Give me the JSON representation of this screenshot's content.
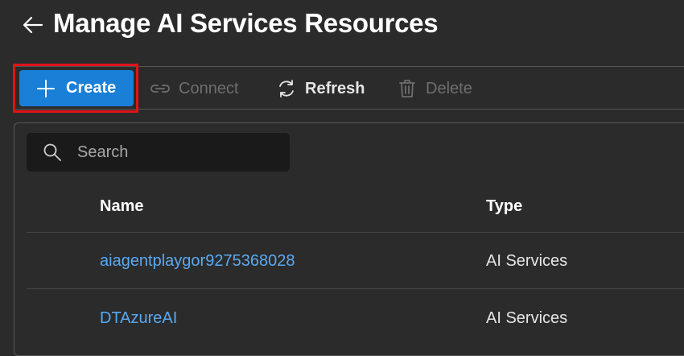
{
  "header": {
    "title": "Manage AI Services Resources"
  },
  "toolbar": {
    "create_label": "Create",
    "connect_label": "Connect",
    "refresh_label": "Refresh",
    "delete_label": "Delete"
  },
  "search": {
    "placeholder": "Search",
    "value": ""
  },
  "table": {
    "columns": [
      "Name",
      "Type"
    ],
    "rows": [
      {
        "name": "aiagentplaygor9275368028",
        "type": "AI Services"
      },
      {
        "name": "DTAzureAI",
        "type": "AI Services"
      }
    ]
  },
  "colors": {
    "background": "#2b2b2b",
    "primary_button": "#1a7fd6",
    "highlight_border": "#e0131b",
    "link": "#5aa9f0",
    "disabled_text": "#6e6e6e"
  },
  "icons": {
    "back": "arrow-left-icon",
    "create": "plus-icon",
    "connect": "link-icon",
    "refresh": "refresh-icon",
    "delete": "trash-icon",
    "search": "search-icon"
  }
}
